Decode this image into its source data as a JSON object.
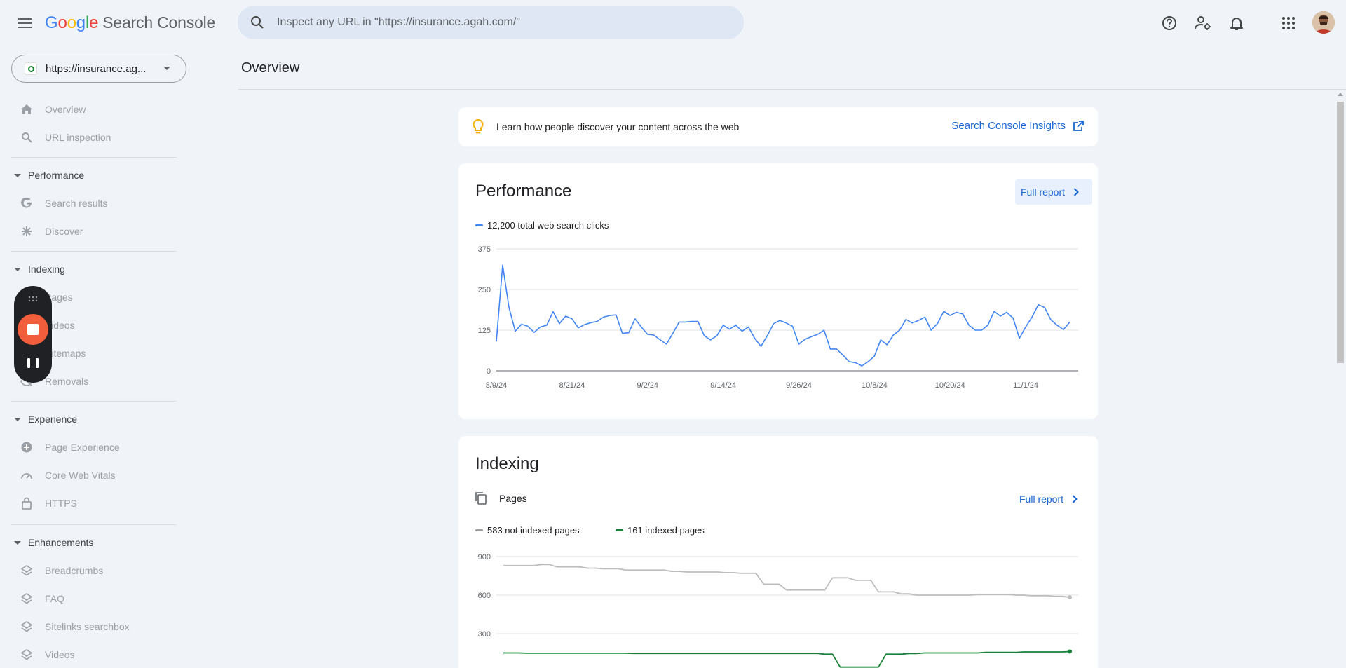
{
  "app": {
    "logo_letters": [
      {
        "ch": "G",
        "color": "#4285F4"
      },
      {
        "ch": "o",
        "color": "#EA4335"
      },
      {
        "ch": "o",
        "color": "#FBBC05"
      },
      {
        "ch": "g",
        "color": "#4285F4"
      },
      {
        "ch": "l",
        "color": "#34A853"
      },
      {
        "ch": "e",
        "color": "#EA4335"
      }
    ],
    "product": "Search Console"
  },
  "search": {
    "placeholder": "Inspect any URL in \"https://insurance.agah.com/\""
  },
  "property": {
    "label": "https://insurance.ag..."
  },
  "sidebar": {
    "overview": "Overview",
    "url_inspection": "URL inspection",
    "performance": "Performance",
    "search_results": "Search results",
    "discover": "Discover",
    "indexing": "Indexing",
    "pages": "Pages",
    "videos": "Videos",
    "sitemaps": "Sitemaps",
    "removals": "Removals",
    "experience": "Experience",
    "page_experience": "Page Experience",
    "core_web_vitals": "Core Web Vitals",
    "https": "HTTPS",
    "enhancements": "Enhancements",
    "breadcrumbs": "Breadcrumbs",
    "faq": "FAQ",
    "sitelinks_searchbox": "Sitelinks searchbox",
    "videos_enh": "Videos"
  },
  "main": {
    "title": "Overview",
    "insight": {
      "message": "Learn how people discover your content across the web",
      "link": "Search Console Insights"
    },
    "performance": {
      "title": "Performance",
      "full_report": "Full report",
      "legend": "12,200 total web search clicks"
    },
    "indexing": {
      "title": "Indexing",
      "subtitle": "Pages",
      "full_report": "Full report",
      "legend_not_indexed": "583 not indexed pages",
      "legend_indexed": "161 indexed pages"
    }
  },
  "colors": {
    "accent": "#1967d2",
    "clicks": "#4285f4",
    "not_indexed": "#bdbdbd",
    "indexed": "#188038"
  },
  "chart_data": [
    {
      "type": "line",
      "ylim": [
        0,
        375
      ],
      "yticks": [
        0,
        125,
        250,
        375
      ],
      "x_tick_labels": [
        "8/9/24",
        "8/21/24",
        "9/2/24",
        "9/14/24",
        "9/26/24",
        "10/8/24",
        "10/20/24",
        "11/1/24"
      ],
      "x_tick_index": [
        0,
        12,
        24,
        36,
        48,
        60,
        72,
        84
      ],
      "series": [
        {
          "name": "12,200 total web search clicks",
          "values": [
            90,
            325,
            195,
            122,
            143,
            137,
            118,
            135,
            140,
            182,
            145,
            168,
            160,
            132,
            142,
            148,
            152,
            165,
            170,
            172,
            115,
            117,
            160,
            135,
            112,
            110,
            95,
            82,
            115,
            150,
            150,
            152,
            152,
            108,
            95,
            108,
            140,
            128,
            140,
            122,
            135,
            100,
            75,
            108,
            145,
            155,
            147,
            137,
            82,
            97,
            105,
            112,
            125,
            67,
            67,
            48,
            28,
            25,
            15,
            28,
            45,
            95,
            80,
            110,
            125,
            158,
            147,
            155,
            165,
            125,
            145,
            183,
            170,
            180,
            175,
            140,
            125,
            125,
            140,
            183,
            168,
            180,
            162,
            100,
            135,
            165,
            203,
            195,
            157,
            140,
            127,
            150
          ]
        }
      ]
    },
    {
      "type": "line",
      "ylim": [
        0,
        900
      ],
      "yticks": [
        300,
        600,
        900
      ],
      "series": [
        {
          "name": "583 not indexed pages",
          "values": [
            830,
            830,
            830,
            830,
            830,
            838,
            838,
            820,
            820,
            820,
            820,
            810,
            810,
            805,
            805,
            805,
            795,
            795,
            795,
            795,
            795,
            795,
            785,
            785,
            780,
            780,
            780,
            780,
            780,
            775,
            775,
            770,
            770,
            770,
            685,
            685,
            685,
            640,
            640,
            640,
            640,
            640,
            640,
            735,
            735,
            735,
            715,
            715,
            715,
            625,
            625,
            625,
            610,
            610,
            600,
            600,
            600,
            600,
            600,
            600,
            600,
            600,
            605,
            605,
            605,
            605,
            605,
            600,
            600,
            595,
            595,
            595,
            590,
            590,
            583
          ]
        },
        {
          "name": "161 indexed pages",
          "values": [
            150,
            150,
            150,
            148,
            148,
            148,
            148,
            148,
            148,
            148,
            148,
            148,
            148,
            148,
            148,
            148,
            148,
            146,
            146,
            146,
            146,
            146,
            146,
            146,
            146,
            146,
            146,
            146,
            146,
            146,
            146,
            146,
            146,
            146,
            146,
            146,
            146,
            146,
            146,
            146,
            146,
            146,
            140,
            140,
            40,
            40,
            40,
            40,
            40,
            40,
            140,
            140,
            140,
            145,
            145,
            150,
            150,
            150,
            150,
            150,
            150,
            150,
            150,
            155,
            155,
            155,
            155,
            155,
            158,
            158,
            158,
            158,
            158,
            158,
            161
          ]
        }
      ]
    }
  ]
}
